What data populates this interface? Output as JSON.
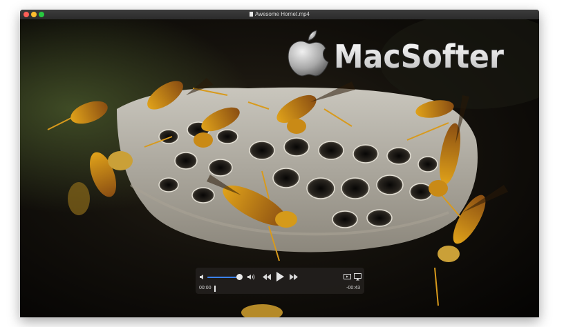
{
  "window": {
    "title": "Awesome Hornet.mp4"
  },
  "watermark": {
    "text": "MacSofter",
    "logo_icon": "apple-icon"
  },
  "player": {
    "elapsed": "00:00",
    "remaining": "-00:43",
    "volume_level": 0.82,
    "playback_progress": 0.0,
    "accent_color": "#3b82f6"
  },
  "icons": {
    "volume_low": "speaker-low-icon",
    "volume_high": "speaker-high-icon",
    "rewind": "rewind-icon",
    "play": "play-icon",
    "fast_forward": "fast-forward-icon",
    "share": "share-icon",
    "airplay": "airplay-icon"
  }
}
